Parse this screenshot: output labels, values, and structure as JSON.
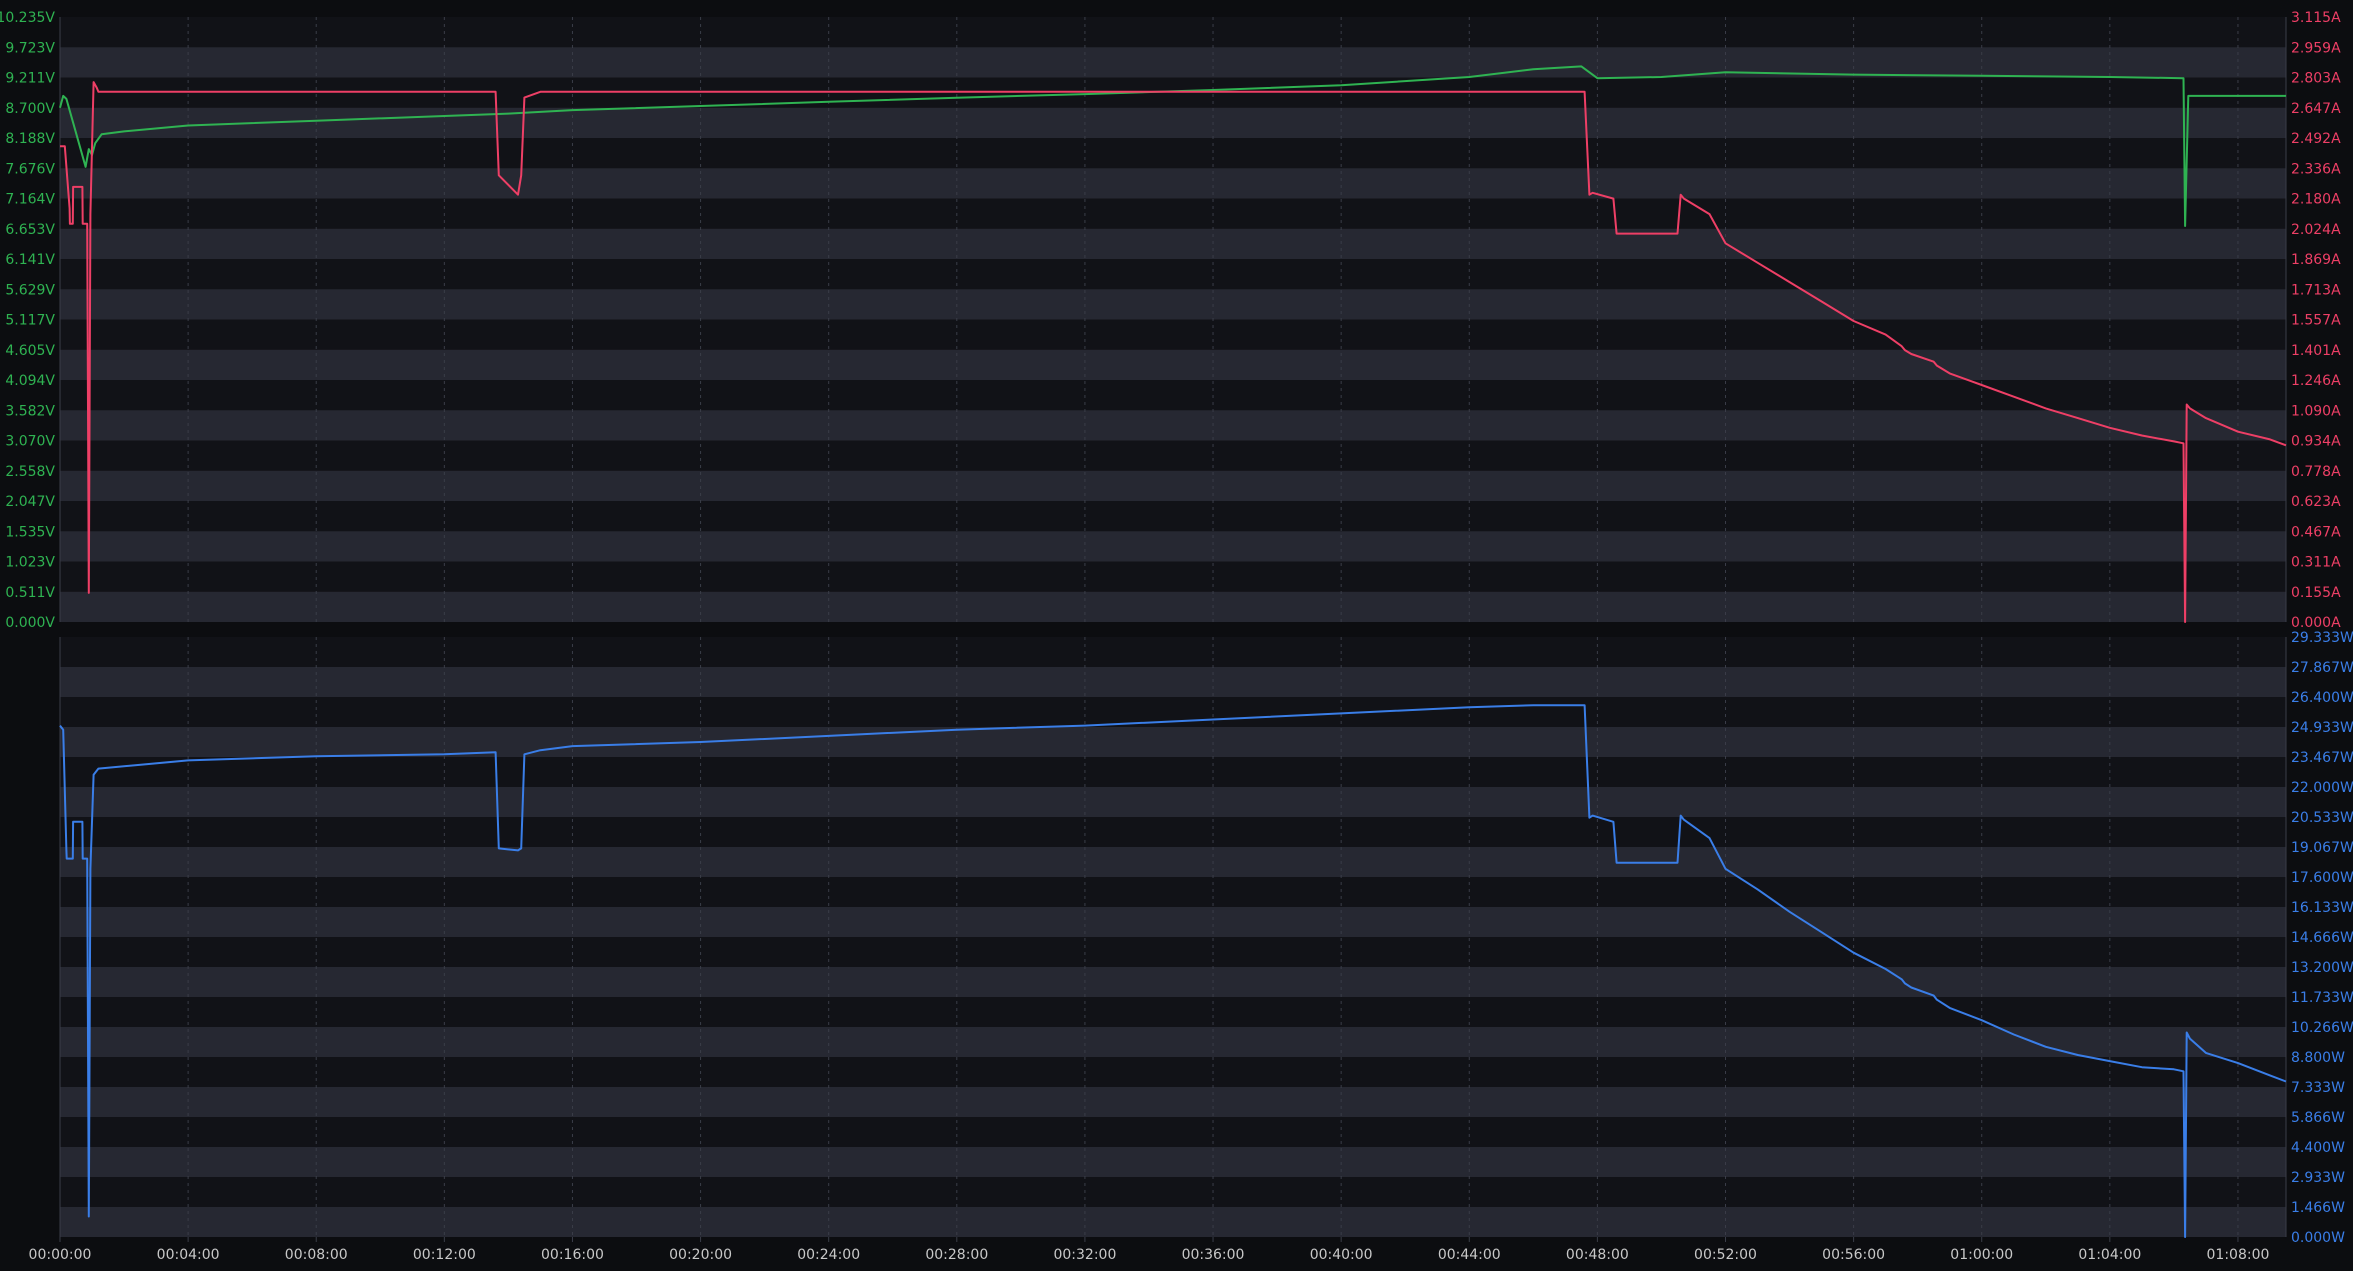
{
  "colors": {
    "background": "#0c0d10",
    "band_dark": "#111217",
    "band_light": "#262832",
    "grid": "#3a3d48",
    "axis_text": "#c8c8c8",
    "voltage": "#2fb352",
    "current": "#ee3f66",
    "power": "#3a7ee8"
  },
  "x_axis": {
    "ticks": [
      "00:00:00",
      "00:04:00",
      "00:08:00",
      "00:12:00",
      "00:16:00",
      "00:20:00",
      "00:24:00",
      "00:28:00",
      "00:32:00",
      "00:36:00",
      "00:40:00",
      "00:44:00",
      "00:48:00",
      "00:52:00",
      "00:56:00",
      "01:00:00",
      "01:04:00",
      "01:08:00"
    ],
    "tick_minutes": [
      0,
      4,
      8,
      12,
      16,
      20,
      24,
      28,
      32,
      36,
      40,
      44,
      48,
      52,
      56,
      60,
      64,
      68
    ],
    "range_minutes": [
      0,
      69.5
    ]
  },
  "chart_data": [
    {
      "type": "line",
      "panel": "voltage-current",
      "left_axis": {
        "unit": "V",
        "ylim": [
          0,
          10.235
        ],
        "ticks": [
          "0.000V",
          "0.511V",
          "1.023V",
          "1.535V",
          "2.047V",
          "2.558V",
          "3.070V",
          "3.582V",
          "4.094V",
          "4.605V",
          "5.117V",
          "5.629V",
          "6.141V",
          "6.653V",
          "7.164V",
          "7.676V",
          "8.188V",
          "8.700V",
          "9.211V",
          "9.723V",
          "10.235V"
        ]
      },
      "right_axis": {
        "unit": "A",
        "ylim": [
          0,
          3.115
        ],
        "ticks": [
          "0.000A",
          "0.155A",
          "0.311A",
          "0.467A",
          "0.623A",
          "0.778A",
          "0.934A",
          "1.090A",
          "1.246A",
          "1.401A",
          "1.557A",
          "1.713A",
          "1.869A",
          "2.024A",
          "2.180A",
          "2.336A",
          "2.492A",
          "2.647A",
          "2.803A",
          "2.959A",
          "3.115A"
        ]
      },
      "series": [
        {
          "key": "voltage",
          "axis": "left",
          "x": [
            0,
            0.1,
            0.2,
            0.8,
            0.9,
            1.0,
            1.1,
            1.3,
            2,
            4,
            8,
            12,
            14,
            16,
            20,
            24,
            28,
            32,
            36,
            40,
            44,
            46,
            47.5,
            48,
            50,
            52,
            56,
            60,
            64,
            66.3,
            66.35,
            66.45,
            69.5
          ],
          "y": [
            8.7,
            8.9,
            8.85,
            7.7,
            8.0,
            7.9,
            8.1,
            8.25,
            8.3,
            8.4,
            8.48,
            8.56,
            8.6,
            8.66,
            8.73,
            8.8,
            8.87,
            8.93,
            9.0,
            9.08,
            9.22,
            9.35,
            9.4,
            9.2,
            9.22,
            9.3,
            9.26,
            9.24,
            9.22,
            9.2,
            6.7,
            8.9,
            8.9
          ]
        },
        {
          "key": "current",
          "axis": "right",
          "x": [
            0,
            0.15,
            0.3,
            0.31,
            0.4,
            0.41,
            0.7,
            0.71,
            0.85,
            0.9,
            0.95,
            1.05,
            1.15,
            1.2,
            4,
            8,
            12,
            13.6,
            13.7,
            14.3,
            14.4,
            14.5,
            15,
            16,
            20,
            24,
            28,
            32,
            36,
            40,
            44,
            46,
            47.6,
            47.75,
            47.85,
            48.5,
            48.6,
            49.5,
            50.5,
            50.6,
            50.7,
            51.5,
            52,
            53,
            54,
            55,
            56,
            57,
            57.5,
            57.6,
            57.8,
            58.5,
            58.6,
            59,
            60,
            61,
            62,
            63,
            64,
            65,
            66,
            66.3,
            66.35,
            66.4,
            66.5,
            67,
            68,
            69,
            69.5
          ],
          "y": [
            2.45,
            2.45,
            2.13,
            2.05,
            2.05,
            2.24,
            2.24,
            2.05,
            2.05,
            0.15,
            2.1,
            2.78,
            2.75,
            2.73,
            2.73,
            2.73,
            2.73,
            2.73,
            2.3,
            2.2,
            2.3,
            2.7,
            2.73,
            2.73,
            2.73,
            2.73,
            2.73,
            2.73,
            2.73,
            2.73,
            2.73,
            2.73,
            2.73,
            2.2,
            2.21,
            2.18,
            2.0,
            2.0,
            2.0,
            2.2,
            2.18,
            2.1,
            1.95,
            1.85,
            1.75,
            1.65,
            1.55,
            1.48,
            1.42,
            1.4,
            1.38,
            1.34,
            1.32,
            1.28,
            1.22,
            1.16,
            1.1,
            1.05,
            1.0,
            0.96,
            0.93,
            0.92,
            0.0,
            1.12,
            1.1,
            1.05,
            0.98,
            0.94,
            0.91
          ]
        }
      ]
    },
    {
      "type": "line",
      "panel": "power",
      "right_axis": {
        "unit": "W",
        "ylim": [
          0,
          29.333
        ],
        "ticks": [
          "0.000W",
          "1.466W",
          "2.933W",
          "4.400W",
          "5.866W",
          "7.333W",
          "8.800W",
          "10.266W",
          "11.733W",
          "13.200W",
          "14.666W",
          "16.133W",
          "17.600W",
          "19.067W",
          "20.533W",
          "22.000W",
          "23.467W",
          "24.933W",
          "26.400W",
          "27.867W",
          "29.333W"
        ]
      },
      "series": [
        {
          "key": "power",
          "axis": "right",
          "x": [
            0,
            0.1,
            0.2,
            0.21,
            0.4,
            0.41,
            0.7,
            0.71,
            0.85,
            0.9,
            0.95,
            1.05,
            1.15,
            1.2,
            4,
            8,
            12,
            13.6,
            13.7,
            14.3,
            14.4,
            14.5,
            15,
            16,
            20,
            24,
            28,
            32,
            36,
            40,
            44,
            46,
            47.6,
            47.75,
            47.85,
            48.5,
            48.6,
            49.5,
            50.5,
            50.6,
            50.7,
            51.5,
            52,
            53,
            54,
            55,
            56,
            57,
            57.5,
            57.6,
            57.8,
            58.5,
            58.6,
            59,
            60,
            61,
            62,
            63,
            64,
            65,
            66,
            66.3,
            66.35,
            66.4,
            66.5,
            67,
            68,
            69,
            69.5
          ],
          "y": [
            25.0,
            24.8,
            18.9,
            18.5,
            18.5,
            20.3,
            20.3,
            18.5,
            18.5,
            1.0,
            18.0,
            22.6,
            22.8,
            22.9,
            23.3,
            23.5,
            23.6,
            23.7,
            19.0,
            18.9,
            19.0,
            23.6,
            23.8,
            24.0,
            24.2,
            24.5,
            24.8,
            25.0,
            25.3,
            25.6,
            25.9,
            26.0,
            26.0,
            20.5,
            20.6,
            20.3,
            18.3,
            18.3,
            18.3,
            20.6,
            20.4,
            19.5,
            18.0,
            17.0,
            15.9,
            14.9,
            13.9,
            13.1,
            12.6,
            12.4,
            12.2,
            11.8,
            11.6,
            11.2,
            10.6,
            9.9,
            9.3,
            8.9,
            8.6,
            8.3,
            8.2,
            8.1,
            0.0,
            10.0,
            9.7,
            9.0,
            8.5,
            7.9,
            7.6
          ]
        }
      ]
    }
  ]
}
